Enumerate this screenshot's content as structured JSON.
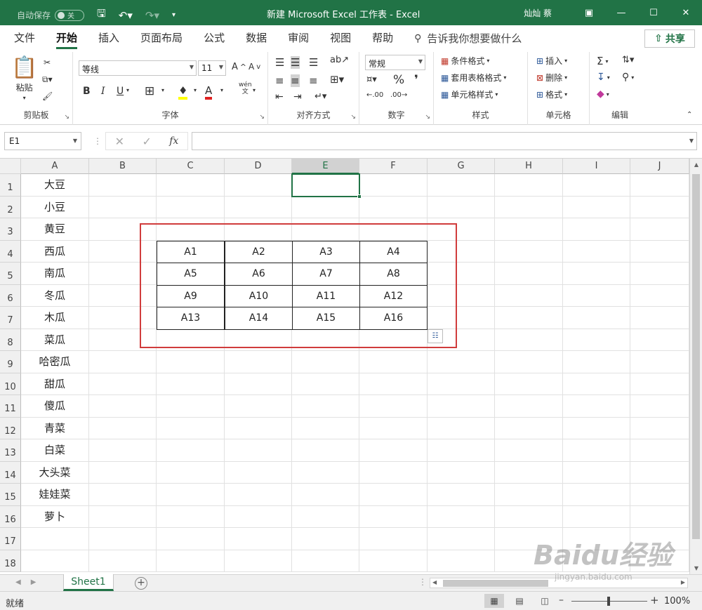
{
  "titlebar": {
    "autosave_label": "自动保存",
    "autosave_state": "关",
    "doc_title": "新建 Microsoft Excel 工作表  -  Excel",
    "user": "灿灿 蔡",
    "bg": "#217346"
  },
  "tabs": [
    "文件",
    "开始",
    "插入",
    "页面布局",
    "公式",
    "数据",
    "审阅",
    "视图",
    "帮助"
  ],
  "active_tab": "开始",
  "tell_me": "告诉我你想要做什么",
  "share": "共享",
  "ribbon": {
    "clipboard": {
      "paste": "粘贴",
      "label": "剪贴板"
    },
    "font": {
      "name": "等线",
      "size": "11",
      "label": "字体",
      "bold": "B",
      "italic": "I",
      "underline": "U",
      "phonetic_top": "wén",
      "phonetic_bottom": "文"
    },
    "alignment": {
      "label": "对齐方式"
    },
    "number": {
      "format": "常规",
      "label": "数字"
    },
    "styles": {
      "conditional": "条件格式",
      "table": "套用表格格式",
      "cell": "单元格样式",
      "label": "样式"
    },
    "cells": {
      "insert": "插入",
      "delete": "删除",
      "format": "格式",
      "label": "单元格"
    },
    "editing": {
      "label": "编辑"
    }
  },
  "formula_bar": {
    "name_box": "E1",
    "fx": "fx",
    "formula": ""
  },
  "columns": [
    "A",
    "B",
    "C",
    "D",
    "E",
    "F",
    "G",
    "H",
    "I",
    "J"
  ],
  "selected_column": "E",
  "rows": [
    "1",
    "2",
    "3",
    "4",
    "5",
    "6",
    "7",
    "8",
    "9",
    "10",
    "11",
    "12",
    "13",
    "14",
    "15",
    "16",
    "17",
    "18"
  ],
  "column_a": [
    "大豆",
    "小豆",
    "黄豆",
    "西瓜",
    "南瓜",
    "冬瓜",
    "木瓜",
    "菜瓜",
    "哈密瓜",
    "甜瓜",
    "傻瓜",
    "青菜",
    "白菜",
    "大头菜",
    "娃娃菜",
    "萝卜"
  ],
  "table": [
    [
      "A1",
      "A2",
      "A3",
      "A4"
    ],
    [
      "A5",
      "A6",
      "A7",
      "A8"
    ],
    [
      "A9",
      "A10",
      "A11",
      "A12"
    ],
    [
      "A13",
      "A14",
      "A15",
      "A16"
    ]
  ],
  "sheet_tab": "Sheet1",
  "status": {
    "text": "就绪",
    "zoom": "100%"
  },
  "watermark": {
    "big": "Baidu经验",
    "small": "jingyan.baidu.com"
  }
}
